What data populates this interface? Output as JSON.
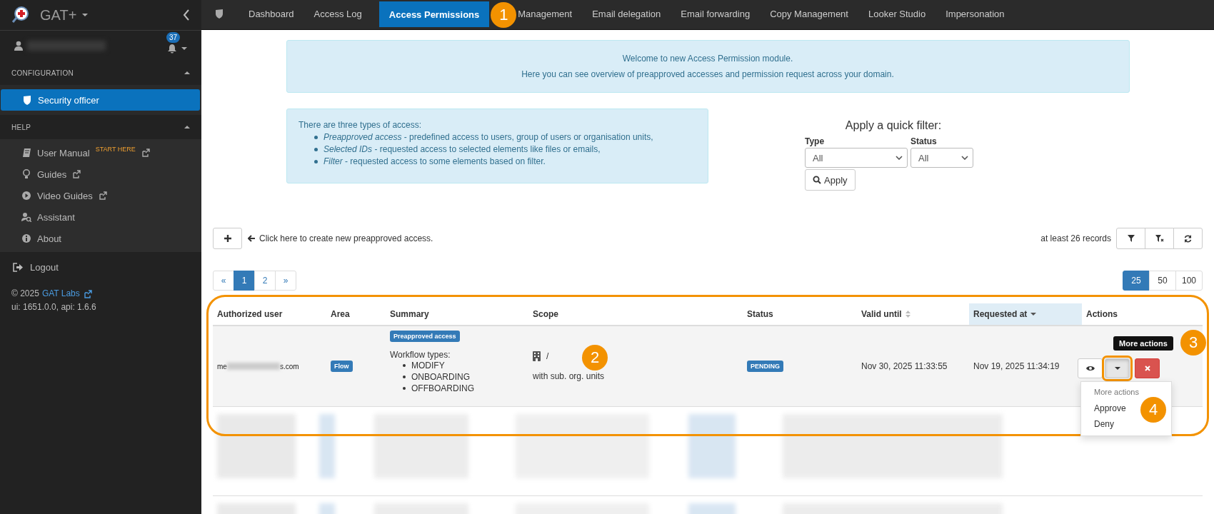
{
  "sidebar": {
    "brand": "GAT+",
    "notification_count": "37",
    "sections": [
      {
        "title": "CONFIGURATION",
        "expanded": true,
        "items": [
          {
            "label": "Security officer",
            "selected": true
          }
        ]
      },
      {
        "title": "HELP",
        "expanded": true,
        "items": [
          {
            "label": "User Manual",
            "tag": "START HERE",
            "external": true,
            "selected": false
          },
          {
            "label": "Guides",
            "external": true,
            "selected": false
          },
          {
            "label": "Video Guides",
            "external": true,
            "selected": false
          },
          {
            "label": "Assistant",
            "external": false,
            "selected": false
          },
          {
            "label": "About",
            "external": false,
            "selected": false
          }
        ]
      }
    ],
    "logout": "Logout",
    "copyright": "© 2025",
    "company_link": "GAT Labs",
    "version": "ui: 1651.0.0, api: 1.6.6"
  },
  "tabs": [
    {
      "label": "Dashboard",
      "selected": false
    },
    {
      "label": "Access Log",
      "selected": false
    },
    {
      "label": "Access Permissions",
      "selected": true,
      "callout": "1"
    },
    {
      "label": "Management",
      "selected": false
    },
    {
      "label": "Email delegation",
      "selected": false
    },
    {
      "label": "Email forwarding",
      "selected": false
    },
    {
      "label": "Copy Management",
      "selected": false
    },
    {
      "label": "Looker Studio",
      "selected": false
    },
    {
      "label": "Impersonation",
      "selected": false
    }
  ],
  "welcome": [
    "Welcome to new Access Permission module.",
    "Here you can see overview of preapproved accesses and permission request across your domain."
  ],
  "info": {
    "intro": "There are three types of access:",
    "items": [
      "*Preapproved access* - predefined access to users, group of users or organisation units,",
      "*Selected IDs* - requested access to selected elements like files or emails,",
      "*Filter* - requested access to some elements based on filter."
    ]
  },
  "quick_filter": {
    "title": "Apply a quick filter:",
    "fields": [
      {
        "label": "Type",
        "value": "All"
      },
      {
        "label": "Status",
        "value": "All"
      }
    ],
    "button": "Apply"
  },
  "toolbar": {
    "create_hint": "Click here to create new preapproved access.",
    "records": "at least 26 records"
  },
  "pagination": {
    "pages": [
      {
        "label": "«",
        "selected": false
      },
      {
        "label": "1",
        "selected": true
      },
      {
        "label": "2",
        "selected": false
      },
      {
        "label": "»",
        "selected": false
      }
    ],
    "page_sizes": [
      {
        "label": "25",
        "selected": true
      },
      {
        "label": "50",
        "selected": false
      },
      {
        "label": "100",
        "selected": false
      }
    ]
  },
  "table": {
    "highlighted": true,
    "columns": [
      {
        "label": "Authorized user",
        "highlighted": false
      },
      {
        "label": "Area",
        "highlighted": false
      },
      {
        "label": "Summary",
        "highlighted": false
      },
      {
        "label": "Scope",
        "highlighted": false
      },
      {
        "label": "Status",
        "highlighted": false
      },
      {
        "label": "Valid until",
        "sortable": true,
        "sorted_descending": false,
        "highlighted": false
      },
      {
        "label": "Requested at",
        "sortable": true,
        "sorted_descending": true,
        "highlighted": true
      },
      {
        "label": "Actions",
        "highlighted": false
      }
    ],
    "rows": [
      {
        "kind": "record",
        "user_start": "me",
        "user_end": "s.com",
        "area": "Flow",
        "summary_tag": "Preapproved access",
        "summary_title": "Workflow types:",
        "summary_items": [
          "MODIFY",
          "ONBOARDING",
          "OFFBOARDING"
        ],
        "scope_path": "/",
        "scope_note": "with sub. org. units",
        "status": "PENDING",
        "valid_until": "Nov 30, 2025 11:33:55",
        "requested_at": "Nov 19, 2025 11:34:19",
        "callout": "2",
        "actions": {
          "tooltip": "More actions",
          "tooltip_callout": "3",
          "more_highlighted": true,
          "menu": {
            "open": true,
            "header": "More actions",
            "items": [
              "Approve",
              "Deny"
            ],
            "callout": "4"
          }
        }
      },
      {
        "kind": "redacted"
      },
      {
        "kind": "redacted"
      }
    ]
  }
}
